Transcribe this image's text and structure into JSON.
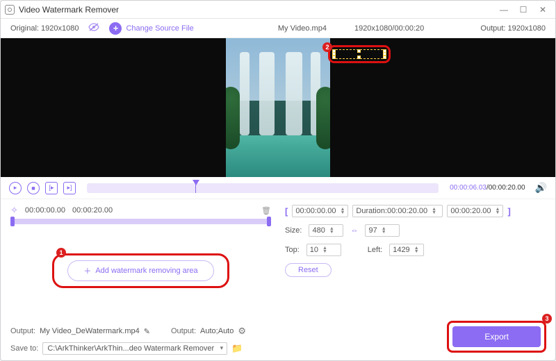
{
  "title": "Video Watermark Remover",
  "infobar": {
    "original_label": "Original:",
    "original_value": "1920x1080",
    "change_source": "Change Source File",
    "filename": "My Video.mp4",
    "dimensions_time": "1920x1080/00:00:20",
    "output_label": "Output:",
    "output_value": "1920x1080"
  },
  "playback": {
    "current": "00:00:06.03",
    "duration": "/00:00:20.00"
  },
  "segment": {
    "start": "00:00:00.00",
    "end": "00:00:20.00"
  },
  "add_area_label": "Add watermark removing area",
  "range": {
    "start": "00:00:00.00",
    "duration_label": "Duration:00:00:20.00",
    "end": "00:00:20.00"
  },
  "size": {
    "label": "Size:",
    "w": "480",
    "h": "97"
  },
  "pos": {
    "top_label": "Top:",
    "top": "10",
    "left_label": "Left:",
    "left": "1429"
  },
  "reset": "Reset",
  "outputs": {
    "file_label": "Output:",
    "file_value": "My Video_DeWatermark.mp4",
    "fmt_label": "Output:",
    "fmt_value": "Auto;Auto",
    "save_label": "Save to:",
    "save_value": "C:\\ArkThinker\\ArkThin...deo Watermark Remover"
  },
  "export": "Export",
  "annotations": {
    "b1": "1",
    "b2": "2",
    "b3": "3"
  }
}
